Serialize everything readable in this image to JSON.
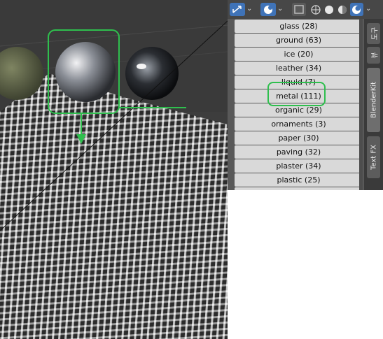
{
  "categories": [
    {
      "label": "glass (28)"
    },
    {
      "label": "ground (63)"
    },
    {
      "label": "ice (20)"
    },
    {
      "label": "leather (34)"
    },
    {
      "label": "liquid (7)"
    },
    {
      "label": "metal (111)"
    },
    {
      "label": "organic (29)"
    },
    {
      "label": "ornaments (3)"
    },
    {
      "label": "paper (30)"
    },
    {
      "label": "paving (32)"
    },
    {
      "label": "plaster (34)"
    },
    {
      "label": "plastic (25)"
    }
  ],
  "side_tabs": [
    {
      "label": "도구"
    },
    {
      "label": "뷰"
    },
    {
      "label": "BlenderKit"
    },
    {
      "label": "Text FX"
    }
  ],
  "toolbar": {
    "icons": [
      "gizmo-icon",
      "overlay-icon",
      "xray-icon",
      "wireframe-shading-icon",
      "solid-shading-icon",
      "material-shading-icon",
      "rendered-shading-icon"
    ]
  },
  "colors": {
    "highlight": "#2fbf4e",
    "active_button": "#3f73b8"
  }
}
